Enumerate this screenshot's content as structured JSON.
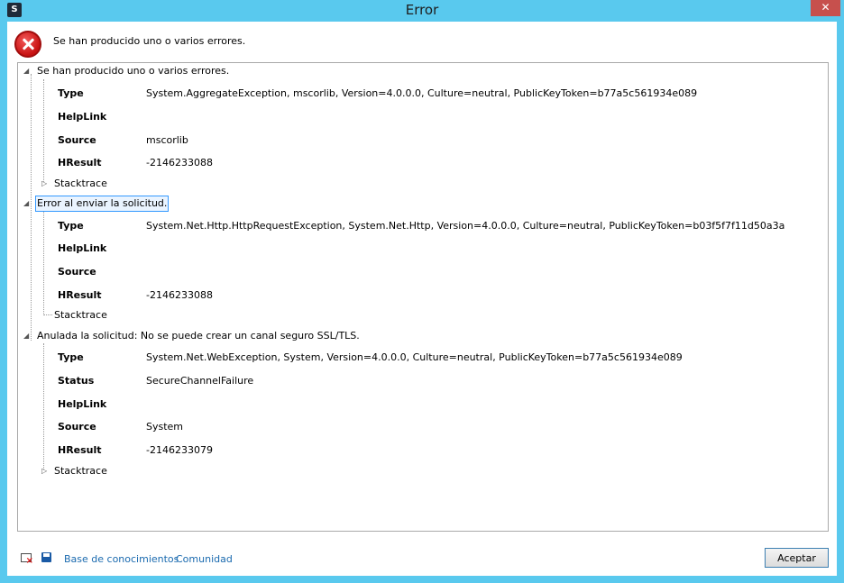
{
  "window": {
    "app_icon": "S",
    "title": "Error",
    "close_glyph": "✕"
  },
  "header": {
    "message": "Se han producido uno o varios errores."
  },
  "tree": {
    "nodes": [
      {
        "label": "Se han producido uno o varios errores.",
        "props": [
          {
            "label": "Type",
            "value": "System.AggregateException, mscorlib, Version=4.0.0.0, Culture=neutral, PublicKeyToken=b77a5c561934e089"
          },
          {
            "label": "HelpLink",
            "value": ""
          },
          {
            "label": "Source",
            "value": "mscorlib"
          },
          {
            "label": "HResult",
            "value": "-2146233088"
          }
        ],
        "stacktrace": "Stacktrace"
      },
      {
        "label": "Error al enviar la solicitud.",
        "props": [
          {
            "label": "Type",
            "value": "System.Net.Http.HttpRequestException, System.Net.Http, Version=4.0.0.0, Culture=neutral, PublicKeyToken=b03f5f7f11d50a3a"
          },
          {
            "label": "HelpLink",
            "value": ""
          },
          {
            "label": "Source",
            "value": ""
          },
          {
            "label": "HResult",
            "value": "-2146233088"
          }
        ],
        "stacktrace": "Stacktrace"
      },
      {
        "label": "Anulada la solicitud: No se puede crear un canal seguro SSL/TLS.",
        "props": [
          {
            "label": "Type",
            "value": "System.Net.WebException, System, Version=4.0.0.0, Culture=neutral, PublicKeyToken=b77a5c561934e089"
          },
          {
            "label": "Status",
            "value": "SecureChannelFailure"
          },
          {
            "label": "HelpLink",
            "value": ""
          },
          {
            "label": "Source",
            "value": "System"
          },
          {
            "label": "HResult",
            "value": "-2146233079"
          }
        ],
        "stacktrace": "Stacktrace"
      }
    ]
  },
  "footer": {
    "knowledge_base": "Base de conocimientos",
    "community": "Comunidad",
    "accept": "Aceptar"
  },
  "icons": {
    "app": "app-logo-icon",
    "error": "error-x-icon",
    "copy": "copy-to-clipboard-icon",
    "save": "save-disk-icon",
    "expanded": "tree-expanded-icon",
    "collapsed": "tree-collapsed-icon"
  },
  "colors": {
    "window_frame": "#59c9ee",
    "close_button": "#c7504d",
    "link": "#1a6aaf",
    "selection_border": "#3399ff"
  }
}
